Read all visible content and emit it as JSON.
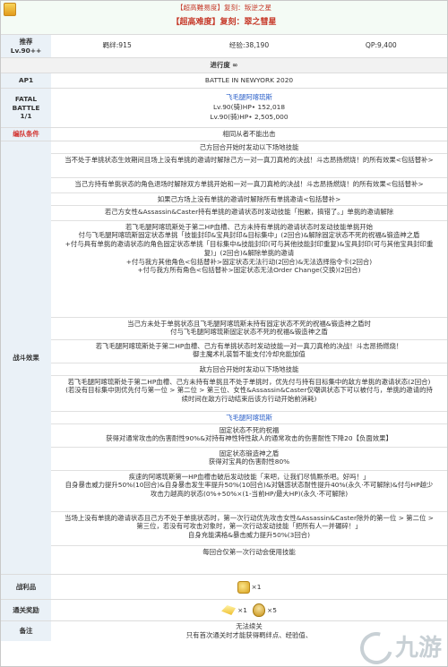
{
  "header": {
    "line1": "【超高難易度】复刻：叛逆之星",
    "line2": "【超高难度】复刻：翠之彗星"
  },
  "level_row": {
    "label_top": "推荐",
    "label_bottom": "Lv.90++",
    "bond": "羁绊:915",
    "exp": "经验:38,190",
    "qp": "QP:9,400"
  },
  "stage_row": {
    "text": "进行度 ∞"
  },
  "ap_row": {
    "label": "AP1",
    "value": "BATTLE IN NEWYORK 2020"
  },
  "fatal_row": {
    "label1": "FATAL",
    "label2": "BATTLE",
    "label3": "1/1",
    "enemy_name": "飞毛腿阿喀琉斯",
    "enemy_hp": "Lv.90(骑)HP• 152,018",
    "enemy_hp2": "Lv.90(骑)HP• 2,505,000"
  },
  "cond_row": {
    "label": "编队条件",
    "value": "相同从者不能出击"
  },
  "battle": {
    "label": "战斗效果",
    "paragraphs": [
      "己方回合开始时发动以下场地技能",
      "当不处于单挑状态生效期间且场上没有单挑的邀请时解除己方一对一真刀真枪的决战！斗志昂扬燃烧！的所有效果<包括替补>",
      "当己方持有单挑状态的角色退场时解除双方单挑开始和一对一真刀真枪的决战！斗志昂扬燃烧！的所有效果<包括替补>",
      "如果己方场上没有单挑的邀请时解除所有单挑邀请<包括替补>",
      "若己方女性&Assassin&Caster持有单挑的邀请状态时发动技能「抱歉，搞错了。」单挑的邀请解除",
      "若飞毛腿阿喀琉斯处于第二HP血槽、己方未持有单挑的邀请状态时发动技能单挑开始\n付与飞毛腿阿喀琉斯固定状态单挑「技能封印&宝具封印&目标集中」(2回合)&解除固定状态不死的祝福&锻造神之盾\n+付与具有单挑的邀请状态的角色固定状态单挑「目标集中&技能封印(可与其他技能封印重复)&宝具封印(可与其他宝具封印重复)」(2回合)&解除单挑的邀请\n+付与我方其他角色<包括替补>固定状态无法行动(2回合)&无法选择指令卡(2回合)\n+付与我方所有角色<包括替补>固定状态无法Order Change(交换)(2回合)",
      "当己方未处于单挑状态且飞毛腿阿喀琉斯未持有固定状态不死的祝福&锻造神之盾时\n付与飞毛腿阿喀琉斯固定状态不死的祝福&锻造神之盾",
      "若飞毛腿阿喀琉斯处于第二HP血槽、己方有单挑状态时发动技能一对一真刀真枪的决战！斗志昂扬燃烧！\n御主魔术礼装暂不能支付冷却充能加值",
      "敌方回合开始时发动以下场地技能",
      "若飞毛腿阿喀琉斯处于第二HP血槽、己方未持有单挑且不处于单挑时，优先付与持有目标集中的敌方单挑的邀请状态(2回合)\n(若没有目标集中则优先付与第一位 > 第二位 > 第三位、女性&Assassin&Caster仅嘲讽状态下可以被付与，单挑的邀请的持续时间在敌方行动结束后该方行动开始前消耗)",
      "飞毛腿阿喀琉斯",
      "固定状态不死的祝福\n获得对通常攻击的伤害耐性90%&对持有神性特性敌人的通常攻击的伤害耐性下降20【负面效果】",
      "固定状态锻造神之盾\n获得对宝具的伤害耐性80%",
      "疾速的阿喀琉斯第一HP血槽击破后发动技能「来吧，让我们尽情厮杀吧。好吗！」\n自身暴击威力提升50%(10回合)&自身暴击发生率提升50%(10回合)&对魅惑状态耐性提升40%(永久·不可解除)&付与HP越少攻击力越高的状态(0%+50%×(1-当前HP/最大HP)(永久·不可解除)",
      "当场上没有单挑的邀请状态且己方不处于单挑状态时，第一次行动优先攻击女性&Assassin&Caster除外的第一位 > 第二位 > 第三位，若没有可攻击对象时，第一次行动发动技能「把所有人一并碾碎！」\n自身充能满格&暴击威力提升50%(3回合)",
      "每回合仅第一次行动会使用技能"
    ]
  },
  "loot": {
    "label": "战利品",
    "count": "×1"
  },
  "reward": {
    "label": "通关奖励",
    "count1": "×1",
    "count2": "×5"
  },
  "remark": {
    "label": "备注",
    "line1": "无法续关",
    "line2": "只有首次通关时才能获得羁绊点、经验值、"
  },
  "watermark": {
    "text": "九游"
  },
  "colors": {
    "header_bg": "#f4fbf5",
    "label_bg": "#eaf1f7",
    "accent_red": "#d2312e",
    "accent_blue": "#2a5fc9"
  }
}
